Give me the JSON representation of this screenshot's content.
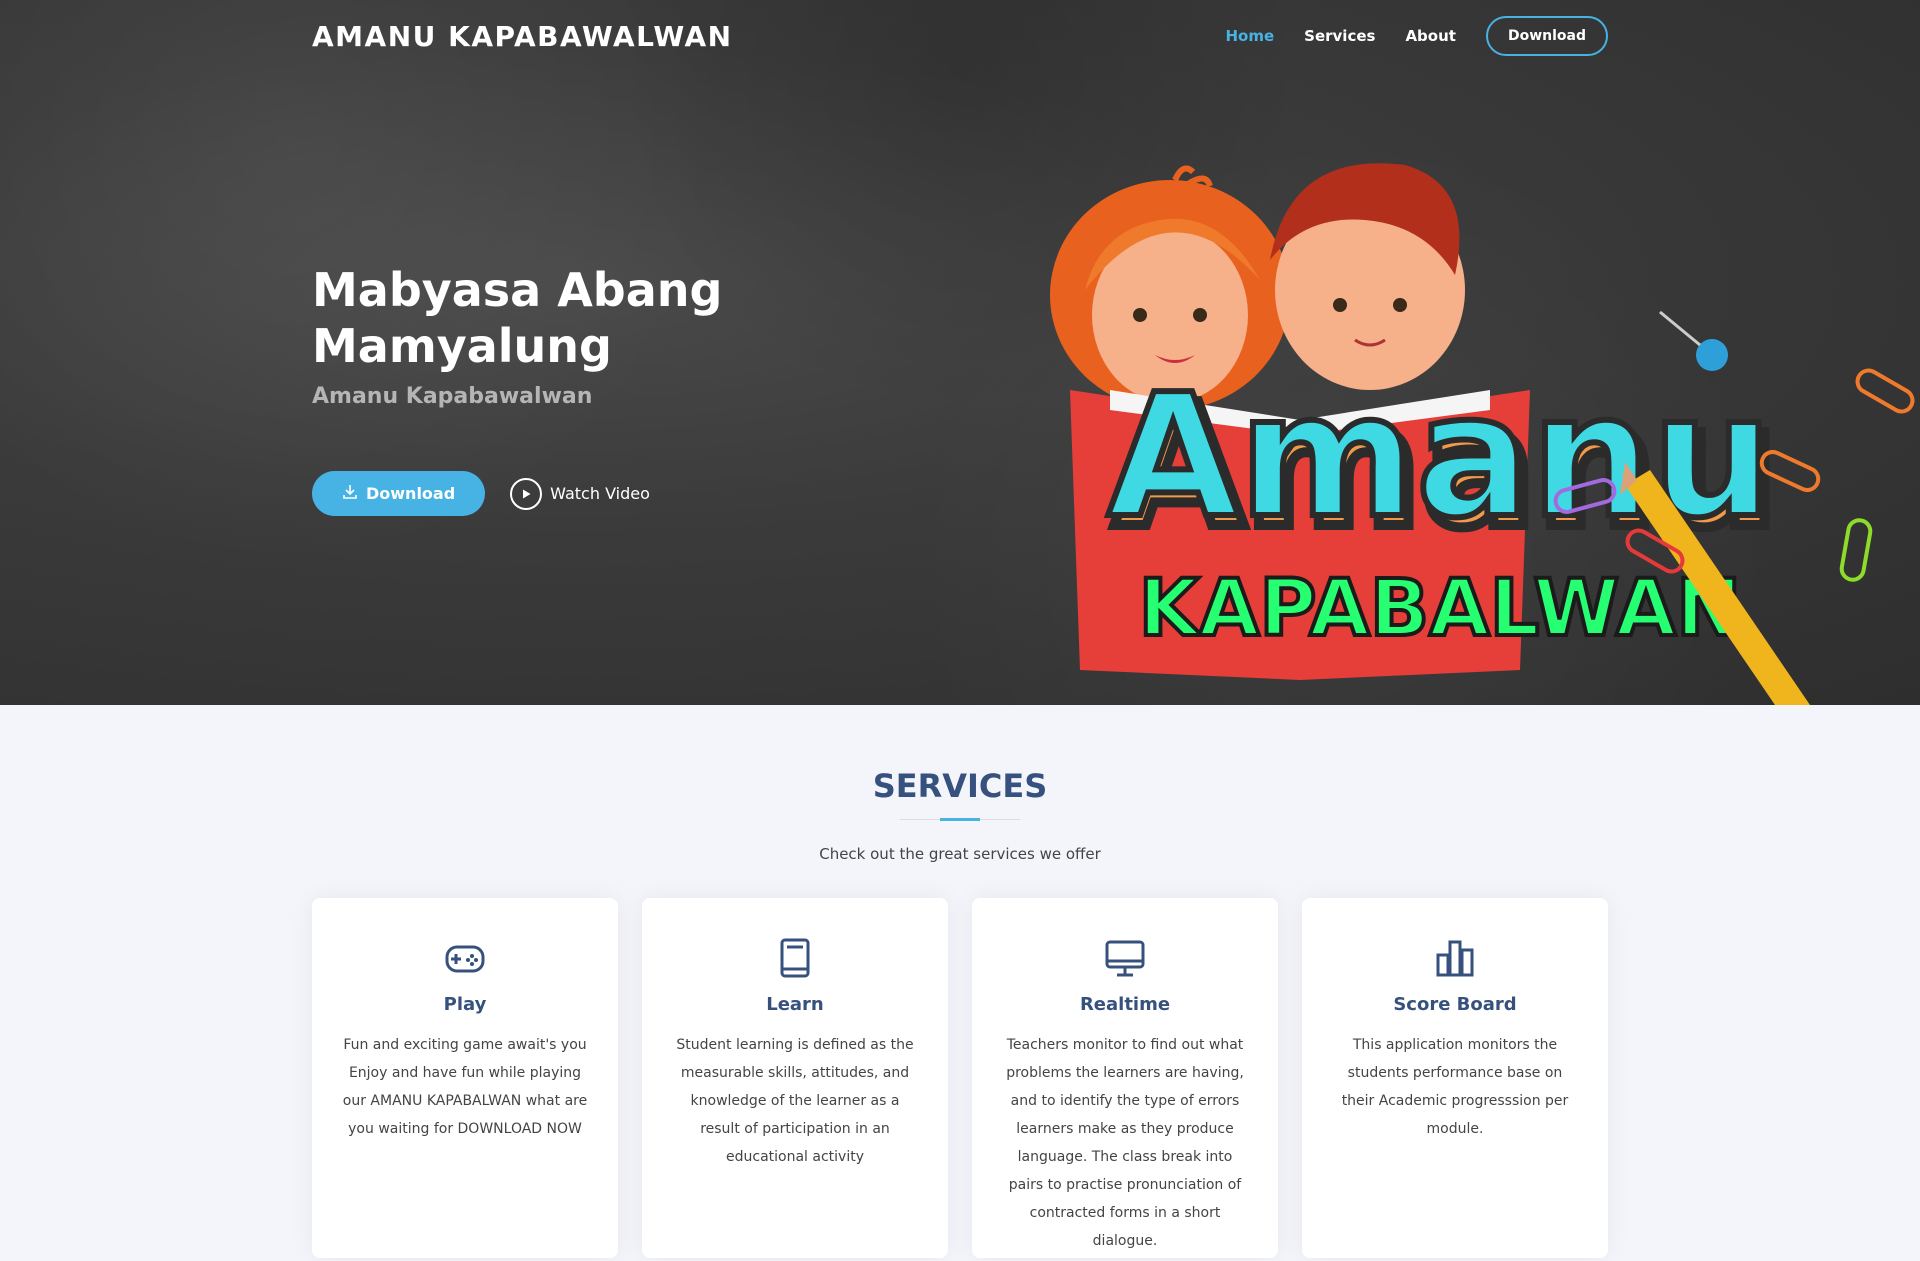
{
  "header": {
    "logo": "AMANU KAPABAWALWAN",
    "nav": [
      {
        "label": "Home",
        "active": true
      },
      {
        "label": "Services"
      },
      {
        "label": "About"
      },
      {
        "label": "Download"
      }
    ]
  },
  "hero": {
    "title_line1": "Mabyasa Abang",
    "title_line2": "Mamyalung",
    "subtitle": "Amanu Kapabawalwan",
    "download_label": "Download",
    "watch_label": "Watch Video",
    "art_word1": "Amanu",
    "art_word2": "KAPABALWAN"
  },
  "services": {
    "title": "SERVICES",
    "description": "Check out the great services we offer",
    "cards": [
      {
        "icon": "gamepad-icon",
        "title": "Play",
        "text": "Fun and exciting game await's you Enjoy and have fun while playing our AMANU KAPABALWAN what are you waiting for DOWNLOAD NOW"
      },
      {
        "icon": "book-icon",
        "title": "Learn",
        "text": "Student learning is defined as the measurable skills, attitudes, and knowledge of the learner as a result of participation in an educational activity"
      },
      {
        "icon": "monitor-icon",
        "title": "Realtime",
        "text": "Teachers monitor to find out what problems the learners are having, and to identify the type of errors learners make as they produce language. The class break into pairs to practise pronunciation of contracted forms in a short dialogue."
      },
      {
        "icon": "bar-chart-icon",
        "title": "Score Board",
        "text": "This application monitors the students performance base on their Academic progresssion per module."
      }
    ]
  },
  "colors": {
    "accent": "#47b2e4",
    "heading": "#37517e",
    "hero_bg": "#3a3a3a"
  }
}
